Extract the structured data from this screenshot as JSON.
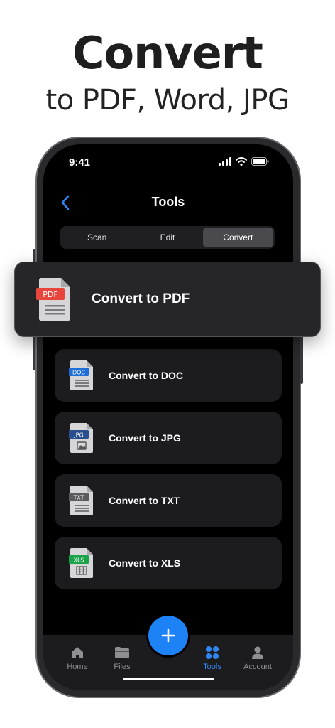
{
  "promo": {
    "headline": "Convert",
    "subline": "to PDF, Word, JPG"
  },
  "status_bar": {
    "time": "9:41",
    "icons": [
      "signal-icon",
      "wifi-icon",
      "battery-icon"
    ]
  },
  "nav": {
    "title": "Tools",
    "back_icon": "chevron-left-icon"
  },
  "segments": [
    {
      "label": "Scan",
      "active": false
    },
    {
      "label": "Edit",
      "active": false
    },
    {
      "label": "Convert",
      "active": true
    }
  ],
  "featured": {
    "label": "Convert to PDF",
    "badge": "PDF",
    "badge_color": "#e8453c"
  },
  "tools": [
    {
      "label": "Convert to DOC",
      "badge": "DOC",
      "badge_color": "#1f6fd6"
    },
    {
      "label": "Convert to JPG",
      "badge": "JPG",
      "badge_color": "#2a4f8f"
    },
    {
      "label": "Convert to TXT",
      "badge": "TXT",
      "badge_color": "#5b5b5f"
    },
    {
      "label": "Convert to XLS",
      "badge": "XLS",
      "badge_color": "#1aa34a"
    }
  ],
  "tabbar": {
    "tabs": [
      {
        "label": "Home",
        "icon": "house-icon",
        "active": false
      },
      {
        "label": "Files",
        "icon": "folder-icon",
        "active": false
      },
      {
        "label": "Tools",
        "icon": "grid-icon",
        "active": true
      },
      {
        "label": "Account",
        "icon": "person-icon",
        "active": false
      }
    ],
    "fab_icon": "plus-icon"
  },
  "colors": {
    "accent": "#1c82f6",
    "background": "#000000",
    "card": "#1c1c1e"
  }
}
